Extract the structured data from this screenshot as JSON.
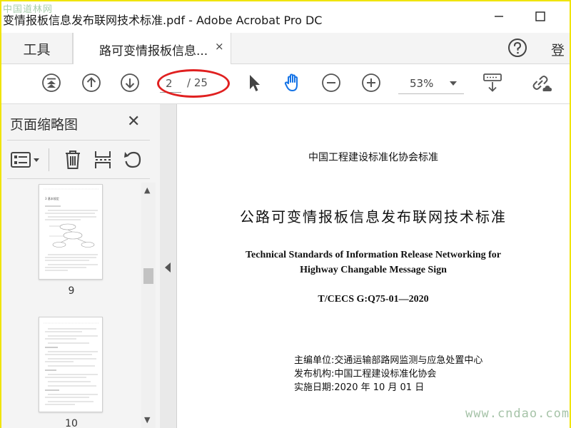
{
  "watermark": {
    "top": "中国道林网",
    "bottom": "www.cndao.com"
  },
  "window": {
    "title": "变情报板信息发布联网技术标准.pdf - Adobe Acrobat Pro DC"
  },
  "tabs": {
    "tools_label": "工具",
    "doc_tab_label": "路可变情报板信息...",
    "close_symbol": "×",
    "signin_label": "登"
  },
  "toolbar": {
    "current_page": "2",
    "total_pages": "/ 25",
    "zoom": "53%",
    "highlight_color": "#e02020",
    "accent_color": "#1473e6"
  },
  "panel": {
    "title": "页面缩略图",
    "close_symbol": "✕"
  },
  "thumbnails": [
    {
      "page_label": "9",
      "top_text": "3 基本规定"
    },
    {
      "page_label": "10"
    }
  ],
  "document": {
    "org": "中国工程建设标准化协会标准",
    "title": "公路可变情报板信息发布联网技术标准",
    "title_en_line1": "Technical Standards of Information Release Networking for",
    "title_en_line2": "Highway Changable Message Sign",
    "code": "T/CECS G:Q75-01—2020",
    "meta": [
      {
        "text": "主编单位:交通运输部路网监测与应急处置中心"
      },
      {
        "text": "发布机构:中国工程建设标准化协会"
      },
      {
        "text": "实施日期:2020 年 10 月 01 日"
      }
    ]
  }
}
